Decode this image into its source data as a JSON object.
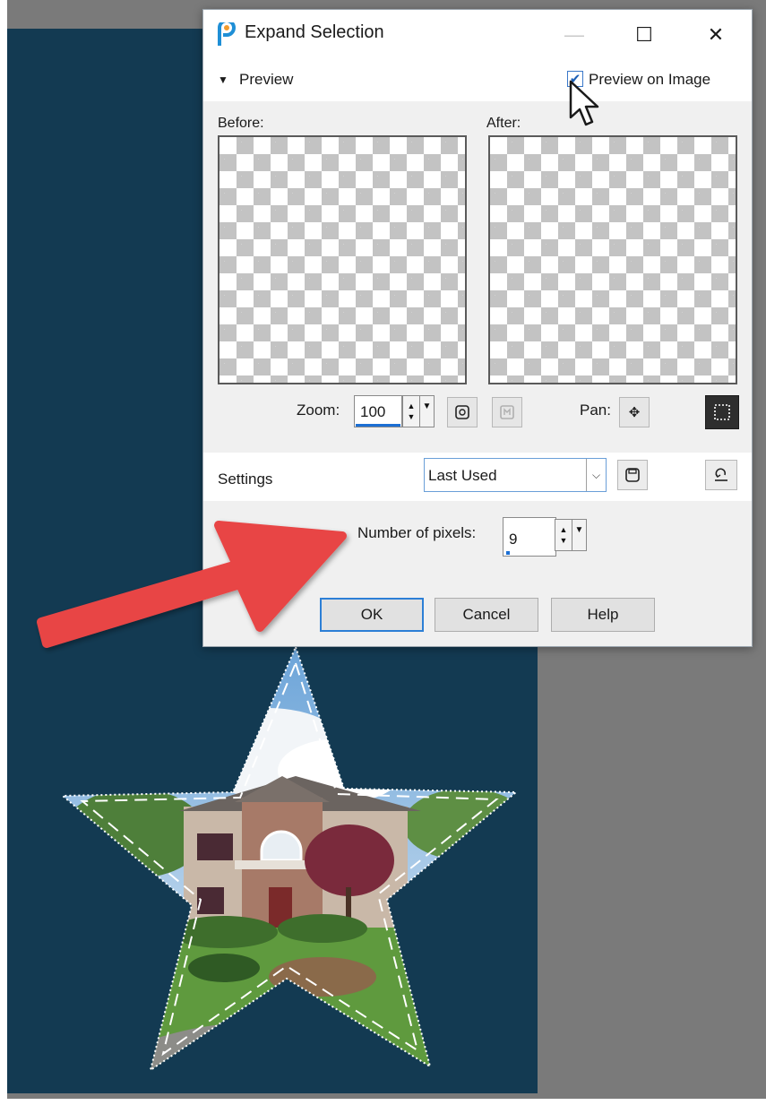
{
  "dialog": {
    "title": "Expand Selection",
    "window_controls": {
      "minimize": "—",
      "maximize": "☐",
      "close": "✕"
    }
  },
  "preview": {
    "section_label": "Preview",
    "preview_on_image_label": "Preview on Image",
    "preview_on_image_checked": true,
    "before_label": "Before:",
    "after_label": "After:"
  },
  "zoom": {
    "label": "Zoom:",
    "value": "100",
    "pan_label": "Pan:"
  },
  "settings": {
    "label": "Settings",
    "preset_value": "Last Used"
  },
  "pixels": {
    "label": "Number of pixels:",
    "value": "9"
  },
  "buttons": {
    "ok": "OK",
    "cancel": "Cancel",
    "help": "Help"
  },
  "icons": {
    "app": "paintshop-icon",
    "collapse": "triangle-down-icon",
    "checkbox": "checkmark-icon",
    "zoom_fit": "zoom-fit-icon",
    "zoom_actual": "zoom-actual-icon",
    "pan": "pan-icon",
    "marquee": "marquee-selection-icon",
    "save_preset": "save-icon",
    "reset": "reset-icon",
    "mouse_cursor": "arrow-cursor-icon",
    "annotation_arrow": "red-arrow-icon"
  },
  "colors": {
    "canvas_background": "#133a52",
    "workspace": "#7a7a7a",
    "annotation_arrow": "#e84545",
    "focus_blue": "#2c7fd6"
  }
}
